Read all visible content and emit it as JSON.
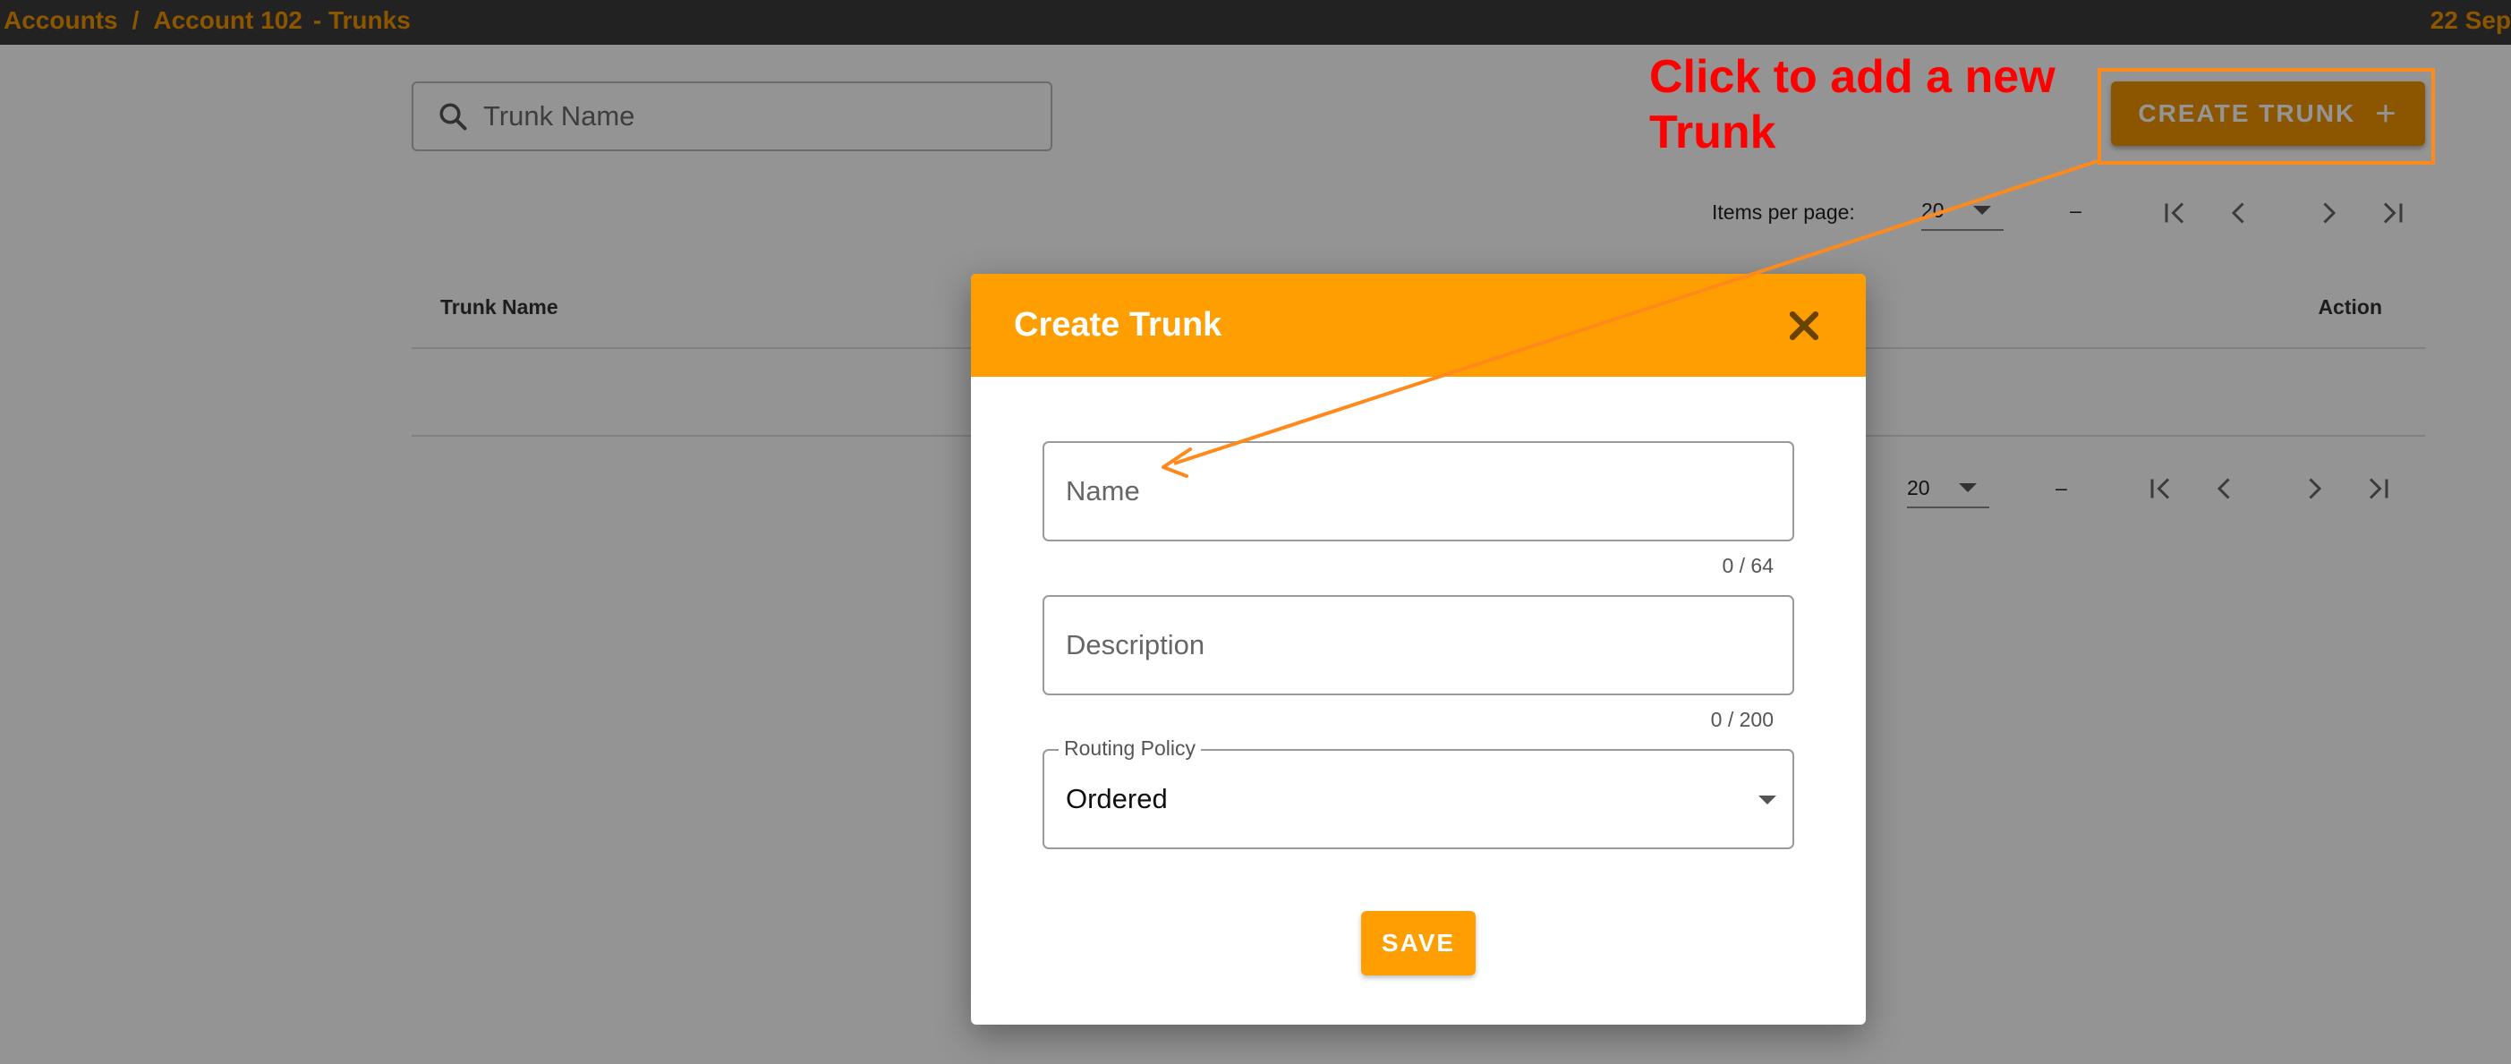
{
  "breadcrumb": {
    "accounts": "Accounts",
    "separator": "/",
    "account": "Account 102",
    "section": "- Trunks"
  },
  "header": {
    "date": "22 Sep"
  },
  "search": {
    "placeholder": "Trunk Name",
    "icon": "search-icon"
  },
  "toolbar": {
    "create_label": "CREATE TRUNK",
    "create_icon": "+"
  },
  "pagination_top": {
    "items_per_page_label": "Items per page:",
    "page_size": "20",
    "range": "–"
  },
  "pagination_bottom": {
    "page_size": "20",
    "range": "–"
  },
  "table": {
    "columns": [
      "Trunk Name",
      "Action"
    ],
    "rows": []
  },
  "dialog": {
    "title": "Create Trunk",
    "name_placeholder": "Name",
    "name_counter": "0 / 64",
    "description_placeholder": "Description",
    "description_counter": "0 / 200",
    "routing_policy_label": "Routing Policy",
    "routing_policy_value": "Ordered",
    "save_label": "SAVE"
  },
  "annotation": {
    "line1": "Click to add a new",
    "line2": "Trunk",
    "text_color": "#ff0000",
    "arrow_color": "#ff8a1c"
  },
  "colors": {
    "accent": "#f29400",
    "dialog_header": "#ff9e00",
    "top_bar": "#3b3b3b"
  }
}
